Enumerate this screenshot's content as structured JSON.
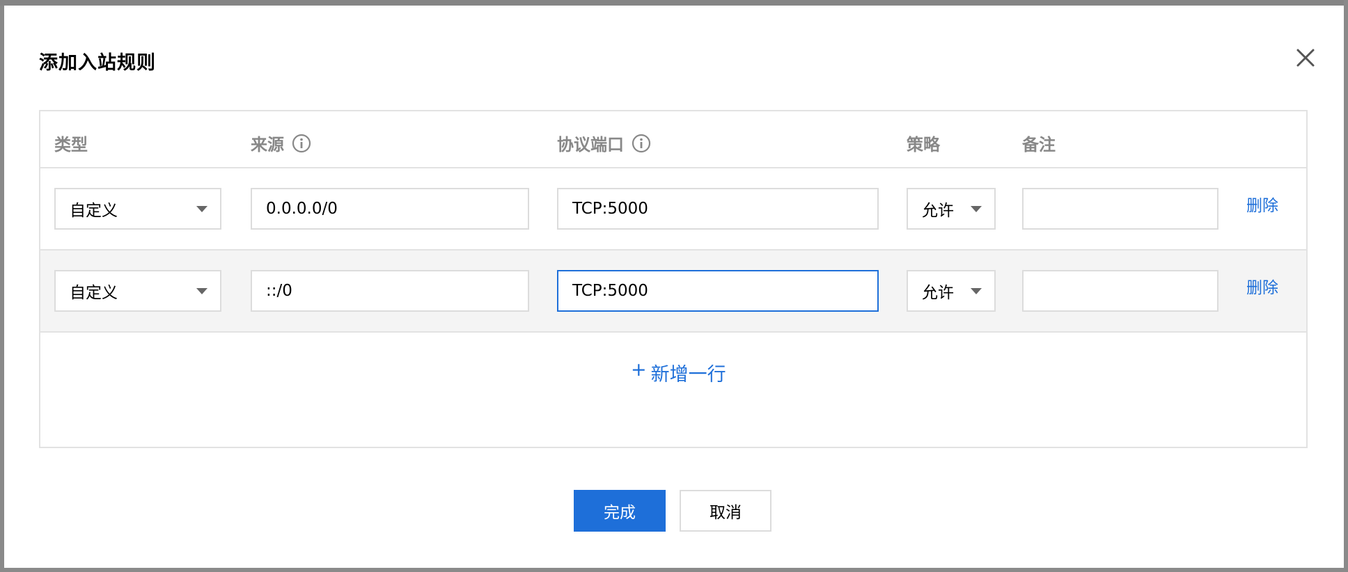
{
  "dialog": {
    "title": "添加入站规则",
    "close_icon": "close-icon"
  },
  "table": {
    "headers": {
      "type": "类型",
      "source": "来源",
      "protocol_port": "协议端口",
      "policy": "策略",
      "note": "备注"
    },
    "rows": [
      {
        "type": "自定义",
        "source": "0.0.0.0/0",
        "protocol_port": "TCP:5000",
        "policy": "允许",
        "note": "",
        "action": "删除"
      },
      {
        "type": "自定义",
        "source": "::/0",
        "protocol_port": "TCP:5000",
        "policy": "允许",
        "note": "",
        "action": "删除"
      }
    ],
    "add_row_plus": "+",
    "add_row_label": "新增一行"
  },
  "footer": {
    "confirm_label": "完成",
    "cancel_label": "取消"
  },
  "colors": {
    "accent": "#1e6fd9",
    "focus_border": "#1e6fd9",
    "header_text": "#888888",
    "row_alt_bg": "#f4f4f4"
  }
}
